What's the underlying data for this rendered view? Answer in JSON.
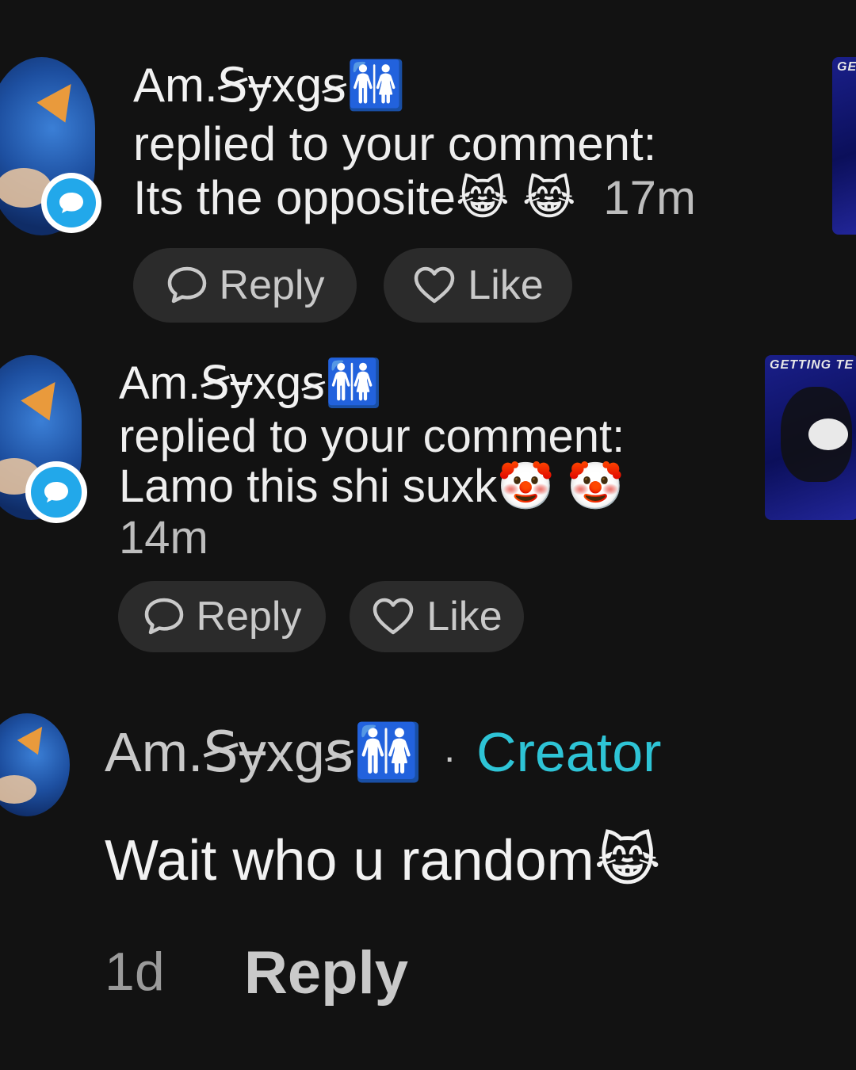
{
  "notifications": [
    {
      "username": "Am.Ꞩɏxgꞩ🚻",
      "action": "replied to your comment:",
      "comment": "Its the opposite",
      "emojis": "😹 😹",
      "time": "17m",
      "reply_label": "Reply",
      "like_label": "Like"
    },
    {
      "username": "Am.Ꞩɏxgꞩ🚻",
      "action": "replied to your comment:",
      "comment": "Lamo this shi suxk",
      "emojis": "🤡 🤡",
      "time": "14m",
      "reply_label": "Reply",
      "like_label": "Like",
      "thumbnail_caption": "GETTING TE"
    }
  ],
  "creator_comment": {
    "username": "Am.Ꞩɏxgꞩ🚻",
    "separator": "·",
    "tag": "Creator",
    "text": "Wait who u random",
    "emoji": "😹",
    "time": "1d",
    "reply_label": "Reply"
  },
  "first_thumbnail_caption": "GE",
  "colors": {
    "background": "#121212",
    "pill": "#2b2b2b",
    "badge": "#22a8ea",
    "creator": "#2ec4d6"
  },
  "icons": [
    "chat-bubble-icon",
    "heart-icon",
    "comment-badge-icon"
  ]
}
